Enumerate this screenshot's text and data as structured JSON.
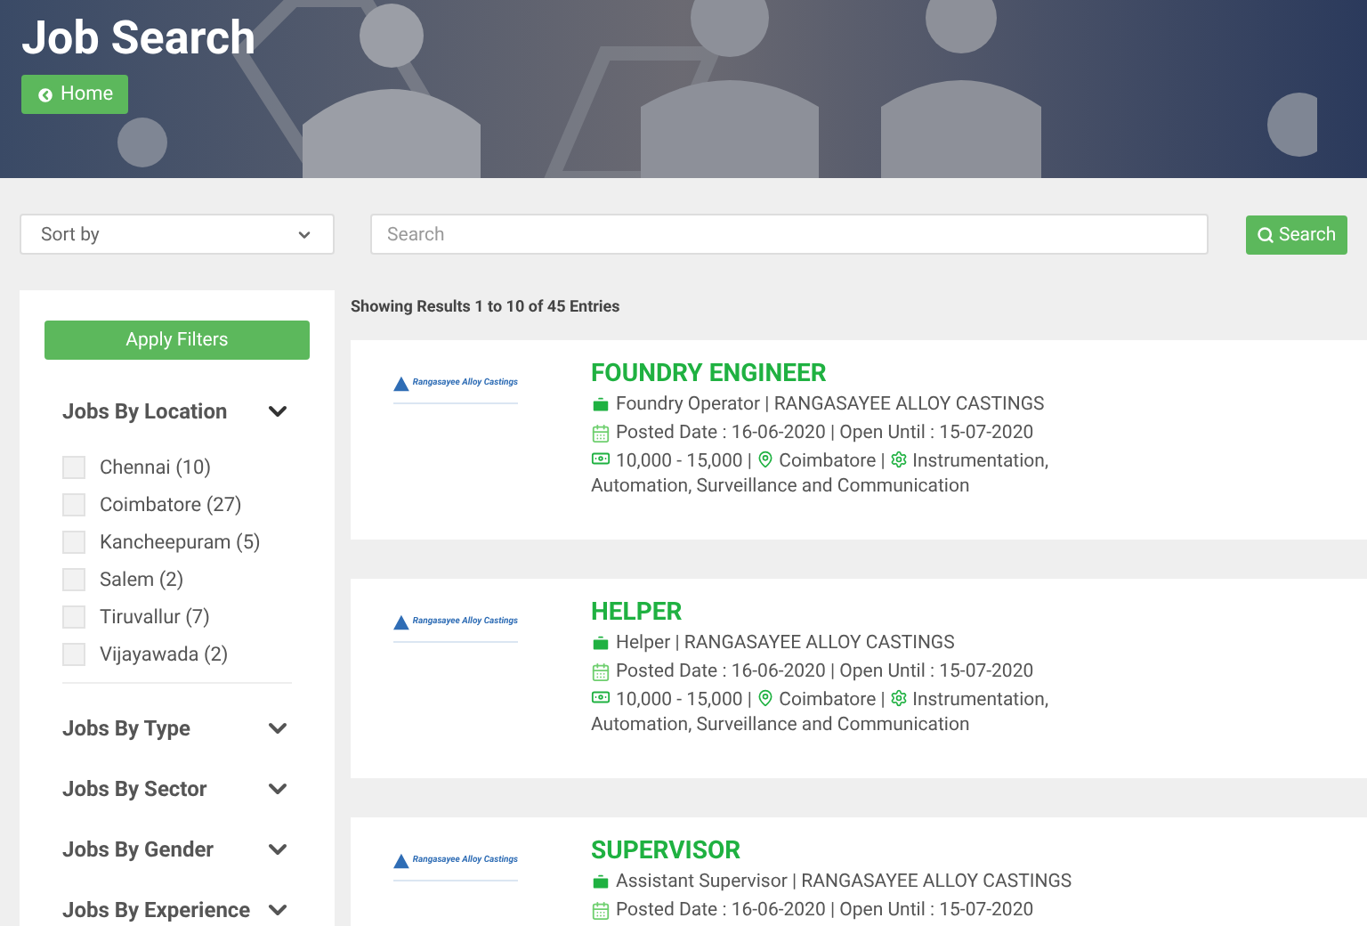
{
  "header": {
    "title": "Job Search",
    "home_button": "Home"
  },
  "toolbar": {
    "sort": {
      "placeholder": "Sort by"
    },
    "search": {
      "placeholder": "Search"
    },
    "search_button": "Search"
  },
  "sidebar": {
    "apply_button": "Apply Filters",
    "filters": [
      {
        "title": "Jobs By Location",
        "expanded": true,
        "options": [
          {
            "label": "Chennai (10)",
            "checked": false
          },
          {
            "label": "Coimbatore (27)",
            "checked": false
          },
          {
            "label": "Kancheepuram (5)",
            "checked": false
          },
          {
            "label": "Salem (2)",
            "checked": false
          },
          {
            "label": "Tiruvallur (7)",
            "checked": false
          },
          {
            "label": "Vijayawada (2)",
            "checked": false
          }
        ]
      },
      {
        "title": "Jobs By Type",
        "expanded": false
      },
      {
        "title": "Jobs By Sector",
        "expanded": false
      },
      {
        "title": "Jobs By Gender",
        "expanded": false
      },
      {
        "title": "Jobs By Experience",
        "expanded": false
      }
    ]
  },
  "results": {
    "summary": "Showing Results 1 to 10 of 45 Entries",
    "jobs": [
      {
        "logo": "Rangasayee Alloy Castings",
        "title": "FOUNDRY ENGINEER",
        "role": "Foundry Operator | RANGASAYEE ALLOY CASTINGS",
        "dates": "Posted Date : 16-06-2020 | Open Until : 15-07-2020",
        "salary": "10,000 - 15,000 |",
        "location": "Coimbatore |",
        "sector": "Instrumentation, Automation, Surveillance and Communication"
      },
      {
        "logo": "Rangasayee Alloy Castings",
        "title": "HELPER",
        "role": "Helper | RANGASAYEE ALLOY CASTINGS",
        "dates": "Posted Date : 16-06-2020 | Open Until : 15-07-2020",
        "salary": "10,000 - 15,000 |",
        "location": "Coimbatore |",
        "sector": "Instrumentation, Automation, Surveillance and Communication"
      },
      {
        "logo": "Rangasayee Alloy Castings",
        "title": "SUPERVISOR",
        "role": "Assistant Supervisor | RANGASAYEE ALLOY CASTINGS",
        "dates": "Posted Date : 16-06-2020 | Open Until : 15-07-2020"
      }
    ]
  }
}
